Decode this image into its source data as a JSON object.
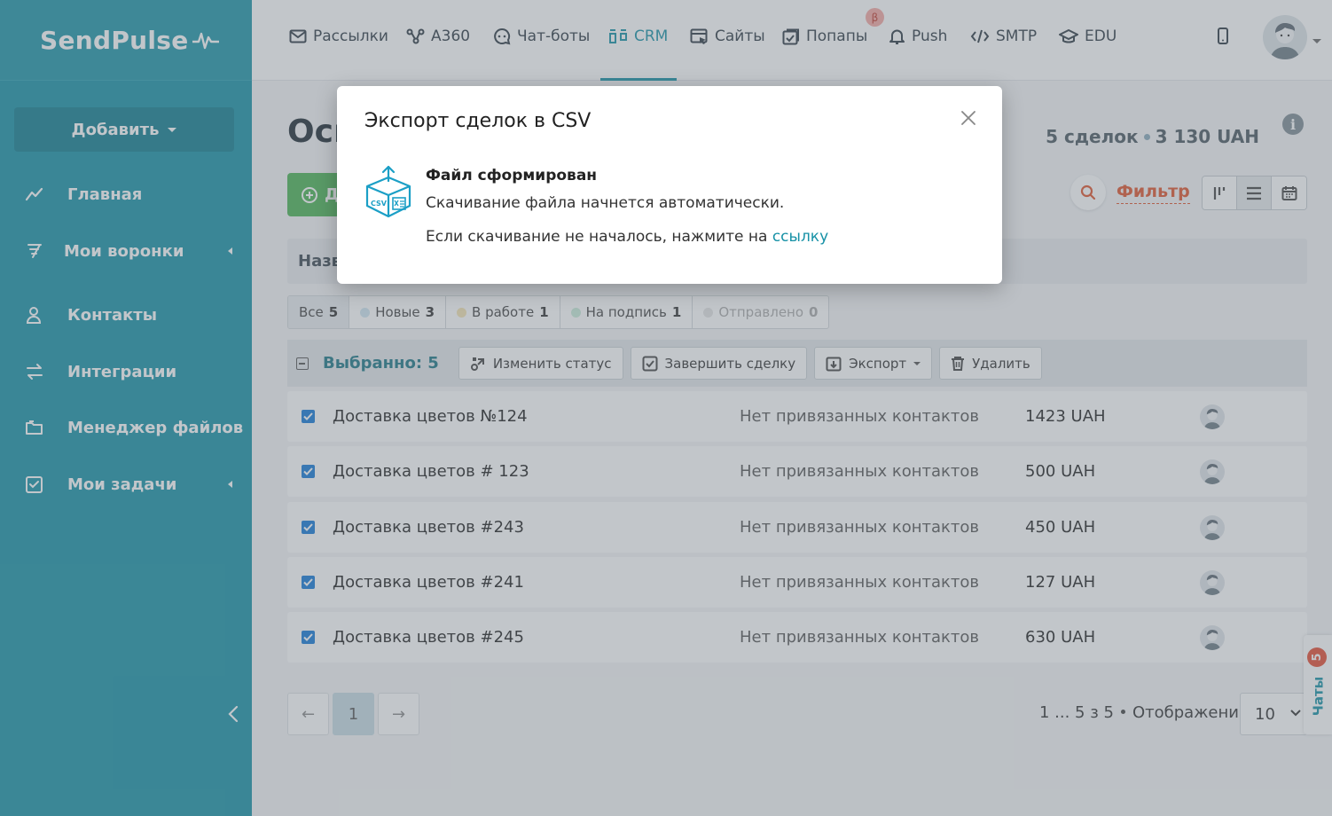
{
  "brand": {
    "name": "SendPulse"
  },
  "sidebar": {
    "add_label": "Добавить",
    "items": [
      {
        "label": "Главная",
        "icon": "chart-line-icon"
      },
      {
        "label": "Мои воронки",
        "icon": "funnel-icon"
      },
      {
        "label": "Контакты",
        "icon": "contacts-icon"
      },
      {
        "label": "Интеграции",
        "icon": "arrows-exchange-icon"
      },
      {
        "label": "Менеджер файлов",
        "icon": "folder-icon"
      },
      {
        "label": "Мои задачи",
        "icon": "task-check-icon"
      }
    ]
  },
  "topnav": {
    "items": [
      {
        "label": "Рассылки",
        "icon": "envelope-icon"
      },
      {
        "label": "A360",
        "icon": "network-icon"
      },
      {
        "label": "Чат-боты",
        "icon": "chat-bot-icon"
      },
      {
        "label": "CRM",
        "icon": "crm-kanban-icon",
        "active": true
      },
      {
        "label": "Сайты",
        "icon": "site-builder-icon"
      },
      {
        "label": "Попапы",
        "icon": "popup-icon"
      },
      {
        "label": "Push",
        "icon": "bell-icon"
      },
      {
        "label": "SMTP",
        "icon": "code-icon"
      },
      {
        "label": "EDU",
        "icon": "graduation-cap-icon"
      }
    ],
    "beta_badge": "β"
  },
  "page": {
    "title": "Осн",
    "deals_count": "5 сделок",
    "deals_total": "3 130 UAH",
    "add_deal_label": "Д",
    "filter_label": "Фильтр",
    "table_head_label": "Назв"
  },
  "status_tabs": [
    {
      "label": "Все",
      "count": "5",
      "color": ""
    },
    {
      "label": "Новые",
      "count": "3",
      "color": "#cfe6f2"
    },
    {
      "label": "В работе",
      "count": "1",
      "color": "#f5e4b1"
    },
    {
      "label": "На подпись",
      "count": "1",
      "color": "#c9ecd9"
    },
    {
      "label": "Отправлено",
      "count": "0",
      "color": "#e4e4e4"
    }
  ],
  "bulk": {
    "selected_label": "Выбранно: 5",
    "change_status": "Изменить статус",
    "complete_deal": "Завершить сделку",
    "export": "Экспорт",
    "delete": "Удалить"
  },
  "deals": [
    {
      "name": "Доставка цветов №124",
      "contact": "Нет привязанных контактов",
      "amount": "1423 UAH"
    },
    {
      "name": "Доставка цветов # 123",
      "contact": "Нет привязанных контактов",
      "amount": "500 UAH"
    },
    {
      "name": "Доставка цветов #243",
      "contact": "Нет привязанных контактов",
      "amount": "450 UAH"
    },
    {
      "name": "Доставка цветов #241",
      "contact": "Нет привязанных контактов",
      "amount": "127 UAH"
    },
    {
      "name": "Доставка цветов #245",
      "contact": "Нет привязанных контактов",
      "amount": "630 UAH"
    }
  ],
  "pagination": {
    "prev": "←",
    "current": "1",
    "next": "→",
    "range": "1 ... 5 з 5",
    "display_label": "Отображение",
    "per_page": "10"
  },
  "chats": {
    "label": "Чаты",
    "badge": "5"
  },
  "modal": {
    "title": "Экспорт сделок в CSV",
    "heading": "Файл сформирован",
    "line1": "Скачивание файла начнется автоматически.",
    "line2": "Если скачивание не началось, нажмите на",
    "link": "ссылку",
    "icon": "csv-export-icon"
  }
}
